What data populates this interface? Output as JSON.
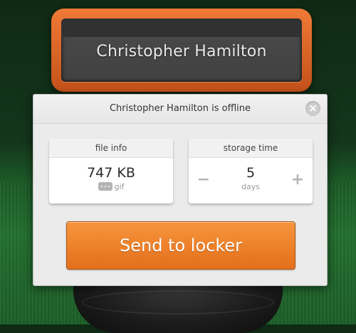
{
  "locker": {
    "owner_name": "Christopher Hamilton"
  },
  "dialog": {
    "title": "Christopher Hamilton is offline",
    "close_icon": "close-icon",
    "file_info": {
      "header": "file info",
      "size": "747 KB",
      "type": "gif",
      "type_icon": "file-type-icon"
    },
    "storage_time": {
      "header": "storage time",
      "value": "5",
      "unit": "days",
      "decrement_label": "−",
      "increment_label": "+"
    },
    "send_button_label": "Send to locker"
  },
  "colors": {
    "accent": "#ef842d",
    "locker_frame": "#e0652a",
    "background": "#1c5a27"
  }
}
